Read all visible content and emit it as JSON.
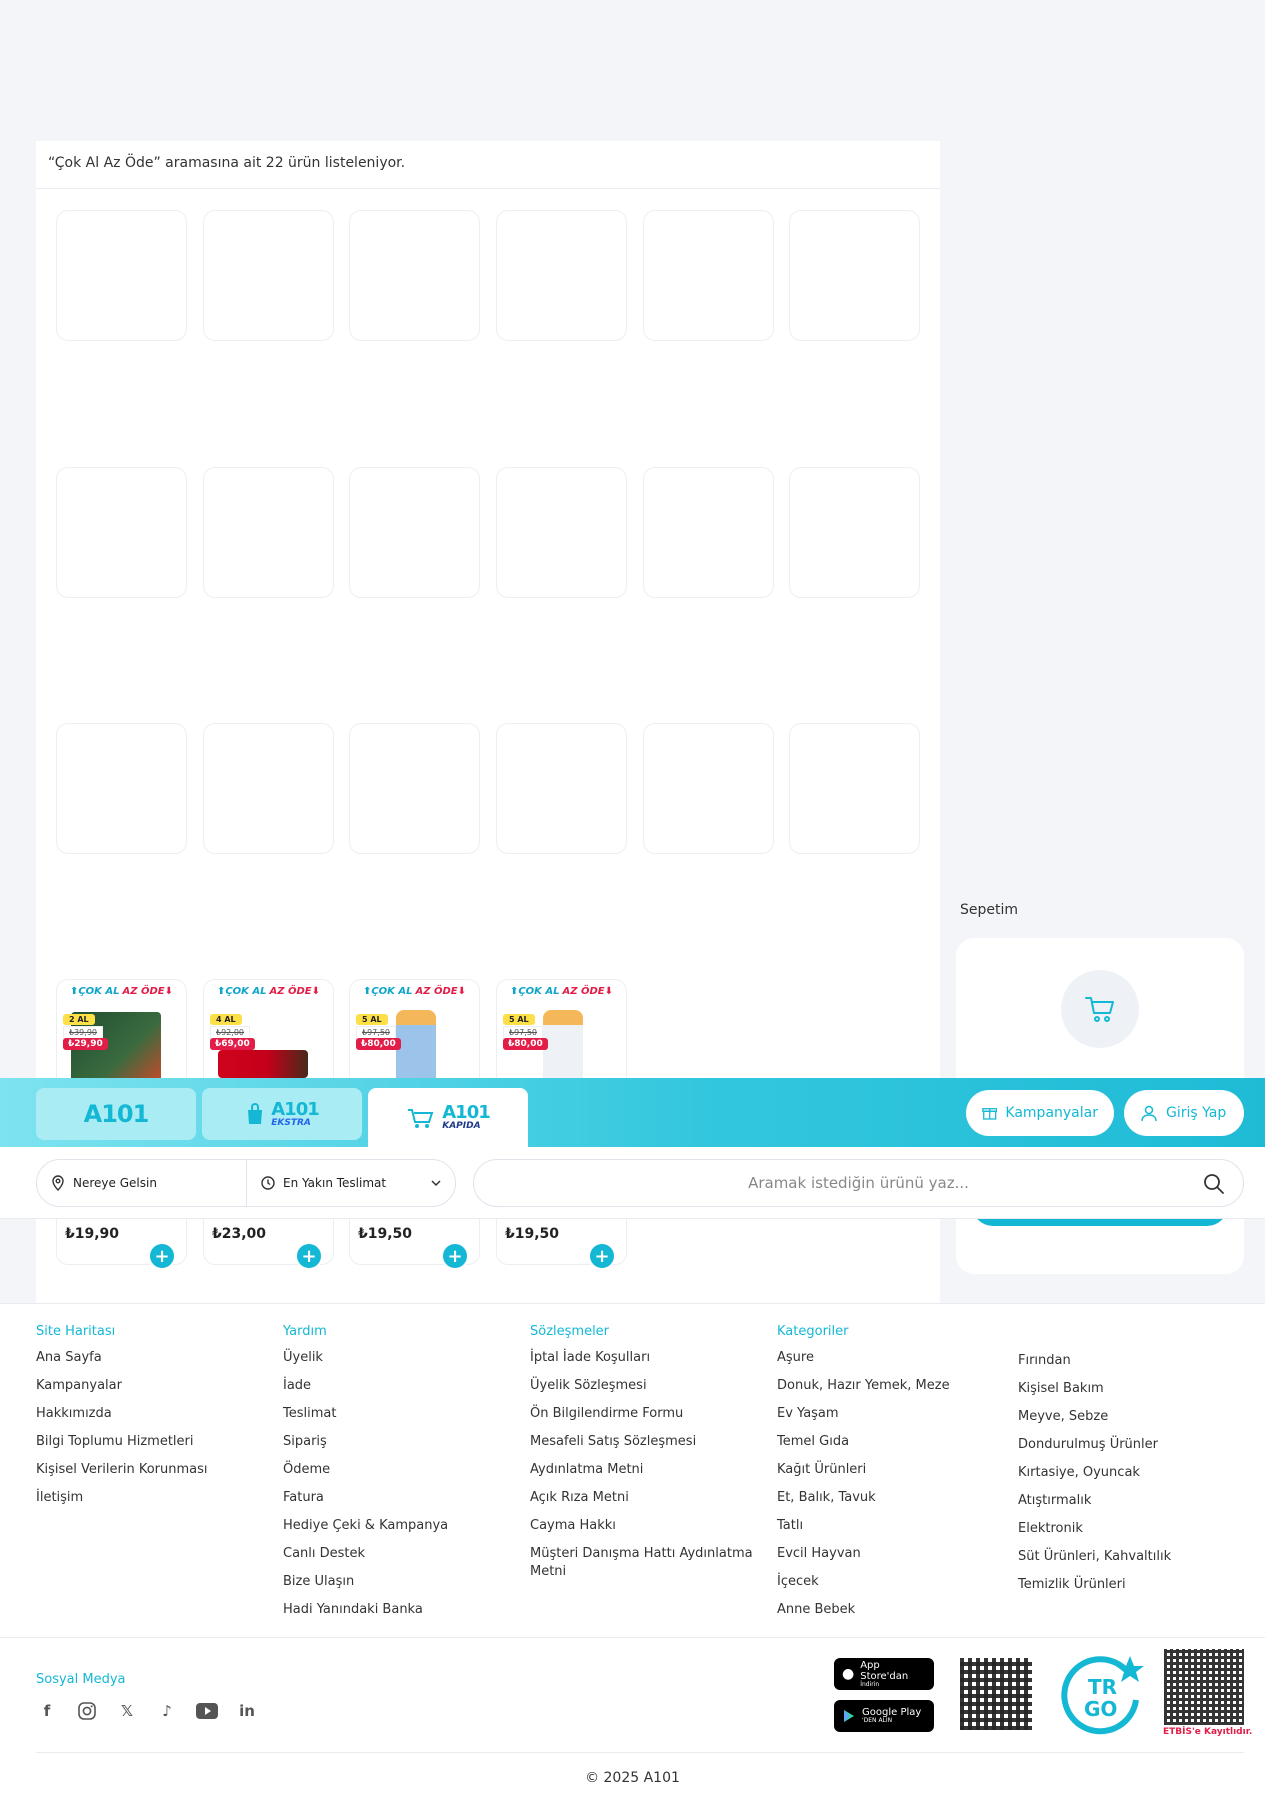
{
  "listing": {
    "result_text": "“Çok Al Az Öde” aramasına ait 22 ürün listeleniyor."
  },
  "products": [
    {
      "promo_a": "ÇOK AL",
      "promo_b": "AZ ÖDE",
      "qty": "2 AL",
      "old_price": "₺39,90",
      "new_price": "₺29,90",
      "price": "₺19,90",
      "image": "soup-pack"
    },
    {
      "promo_a": "ÇOK AL",
      "promo_b": "AZ ÖDE",
      "qty": "4 AL",
      "old_price": "₺92,00",
      "new_price": "₺69,00",
      "price": "₺23,00",
      "image": "kitkat-chunky"
    },
    {
      "promo_a": "ÇOK AL",
      "promo_b": "AZ ÖDE",
      "qty": "5 AL",
      "old_price": "₺97,50",
      "new_price": "₺80,00",
      "price": "₺19,50",
      "image": "razor-blue"
    },
    {
      "promo_a": "ÇOK AL",
      "promo_b": "AZ ÖDE",
      "qty": "5 AL",
      "old_price": "₺97,50",
      "new_price": "₺80,00",
      "price": "₺19,50",
      "image": "razor-white"
    }
  ],
  "cart": {
    "title": "Sepetim",
    "login_label": "Giriş Yap"
  },
  "header": {
    "brand_main": "A101",
    "brand_ekstra_sub": "EKSTRA",
    "brand_kapida_sub": "KAPIDA",
    "campaigns_label": "Kampanyalar",
    "login_label": "Giriş Yap",
    "location_label": "Nereye Gelsin",
    "delivery_label": "En Yakın Teslimat",
    "search_placeholder": "Aramak istediğin ürünü yaz..."
  },
  "footer": {
    "columns": [
      {
        "title": "Site Haritası",
        "items": [
          "Ana Sayfa",
          "Kampanyalar",
          "Hakkımızda",
          "Bilgi Toplumu Hizmetleri",
          "Kişisel Verilerin Korunması",
          "İletişim"
        ]
      },
      {
        "title": "Yardım",
        "items": [
          "Üyelik",
          "İade",
          "Teslimat",
          "Sipariş",
          "Ödeme",
          "Fatura",
          "Hediye Çeki & Kampanya",
          "Canlı Destek",
          "Bize Ulaşın",
          "Hadi Yanındaki Banka"
        ]
      },
      {
        "title": "Sözleşmeler",
        "items": [
          "İptal İade Koşulları",
          "Üyelik Sözleşmesi",
          "Ön Bilgilendirme Formu",
          "Mesafeli Satış Sözleşmesi",
          "Aydınlatma Metni",
          "Açık Rıza Metni",
          "Cayma Hakkı",
          "Müşteri Danışma Hattı Aydınlatma Metni"
        ]
      },
      {
        "title": "Kategoriler",
        "items": [
          "Aşure",
          "Donuk, Hazır Yemek, Meze",
          "Ev Yaşam",
          "Temel Gıda",
          "Kağıt Ürünleri",
          "Et, Balık, Tavuk",
          "Tatlı",
          "Evcil Hayvan",
          "İçecek",
          "Anne Bebek"
        ]
      },
      {
        "title": "",
        "items": [
          "Fırından",
          "Kişisel Bakım",
          "Meyve, Sebze",
          "Dondurulmuş Ürünler",
          "Kırtasiye, Oyuncak",
          "Atıştırmalık",
          "Elektronik",
          "Süt Ürünleri, Kahvaltılık",
          "Temizlik Ürünleri"
        ]
      }
    ],
    "social_title": "Sosyal Medya",
    "social_icons": [
      "facebook-icon",
      "instagram-icon",
      "x-icon",
      "tiktok-icon",
      "youtube-icon",
      "linkedin-icon"
    ],
    "app_store_label": "App Store'dan",
    "app_store_sub": "İndirin",
    "google_play_label": "Google Play",
    "google_play_sub": "'DEN ALIN",
    "trgo_label": "TR GO",
    "etbis_label": "ETBİS'e Kayıtlıdır.",
    "copyright": "© 2025 A101"
  },
  "colors": {
    "accent": "#14b8d4",
    "header_gradient_start": "#7ee3ef",
    "header_gradient_end": "#1fbbd6",
    "promo_red": "#e11d48",
    "badge_yellow": "#fde047"
  }
}
